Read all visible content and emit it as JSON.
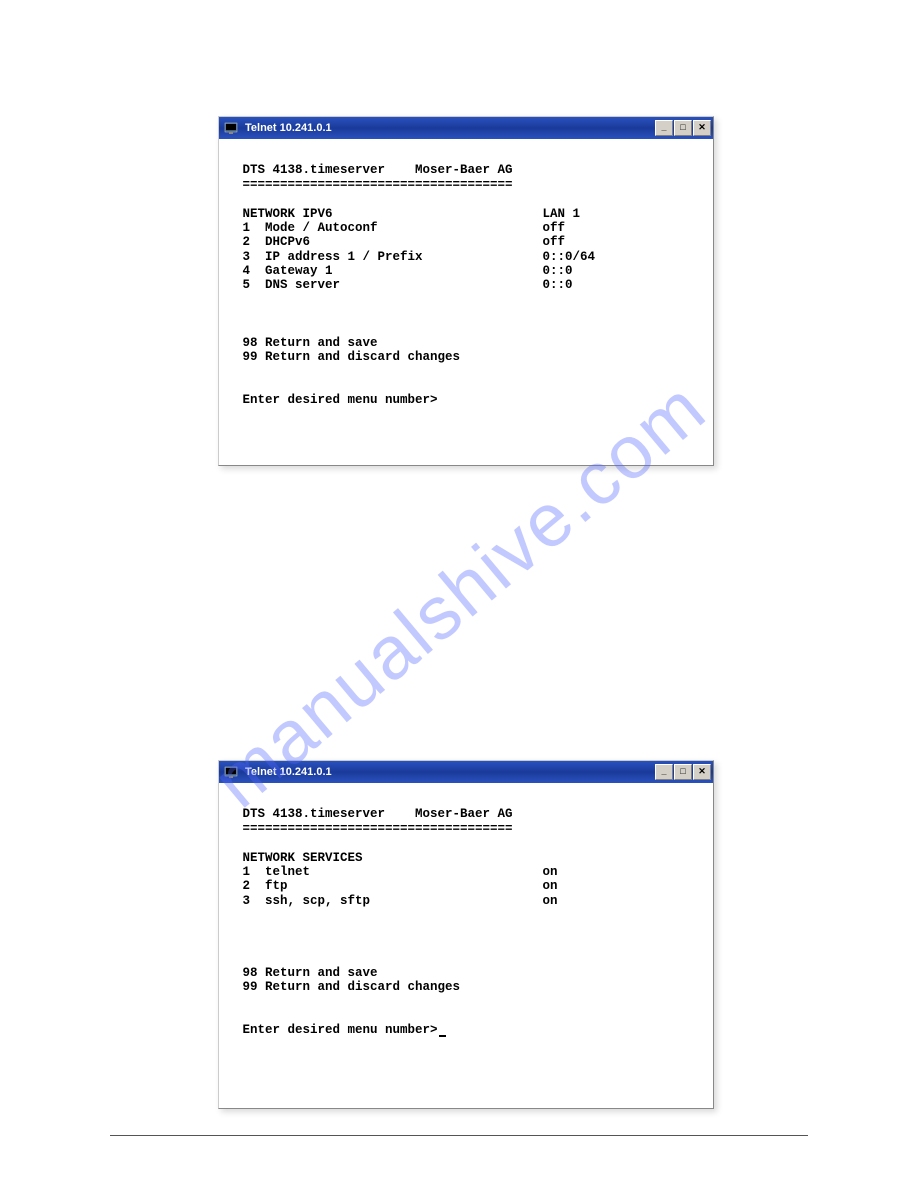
{
  "watermark": "manualshive.com",
  "window1": {
    "title": "Telnet 10.241.0.1",
    "header_app": " DTS 4138.timeserver    Moser-Baer AG",
    "divider": " ====================================",
    "section_title": " NETWORK IPV6                            LAN 1",
    "item1": " 1  Mode / Autoconf                      off",
    "item2": " 2  DHCPv6                               off",
    "item3": " 3  IP address 1 / Prefix                0::0/64",
    "item4": " 4  Gateway 1                            0::0",
    "item5": " 5  DNS server                           0::0",
    "opt98": " 98 Return and save",
    "opt99": " 99 Return and discard changes",
    "prompt": " Enter desired menu number>"
  },
  "window2": {
    "title": "Telnet 10.241.0.1",
    "header_app": " DTS 4138.timeserver    Moser-Baer AG",
    "divider": " ====================================",
    "section_title": " NETWORK SERVICES",
    "item1": " 1  telnet                               on",
    "item2": " 2  ftp                                  on",
    "item3": " 3  ssh, scp, sftp                       on",
    "opt98": " 98 Return and save",
    "opt99": " 99 Return and discard changes",
    "prompt": " Enter desired menu number>"
  },
  "win_buttons": {
    "min": "_",
    "max": "□",
    "close": "✕"
  }
}
